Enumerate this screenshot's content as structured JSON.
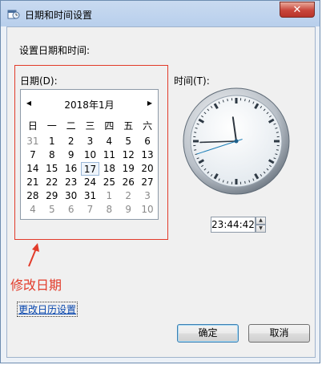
{
  "window": {
    "title": "日期和时间设置",
    "close_label": "✕"
  },
  "heading": "设置日期和时间:",
  "date": {
    "label": "日期(D):",
    "month_title": "2018年1月",
    "prev_glyph": "◀",
    "next_glyph": "▶",
    "weekdays": [
      "日",
      "一",
      "二",
      "三",
      "四",
      "五",
      "六"
    ],
    "days": [
      {
        "t": "31",
        "o": true
      },
      {
        "t": "1"
      },
      {
        "t": "2"
      },
      {
        "t": "3"
      },
      {
        "t": "4"
      },
      {
        "t": "5"
      },
      {
        "t": "6"
      },
      {
        "t": "7"
      },
      {
        "t": "8"
      },
      {
        "t": "9"
      },
      {
        "t": "10"
      },
      {
        "t": "11"
      },
      {
        "t": "12"
      },
      {
        "t": "13"
      },
      {
        "t": "14"
      },
      {
        "t": "15"
      },
      {
        "t": "16"
      },
      {
        "t": "17",
        "sel": true
      },
      {
        "t": "18"
      },
      {
        "t": "19"
      },
      {
        "t": "20"
      },
      {
        "t": "21"
      },
      {
        "t": "22"
      },
      {
        "t": "23"
      },
      {
        "t": "24"
      },
      {
        "t": "25"
      },
      {
        "t": "26"
      },
      {
        "t": "27"
      },
      {
        "t": "28"
      },
      {
        "t": "29"
      },
      {
        "t": "30"
      },
      {
        "t": "31"
      },
      {
        "t": "1",
        "o": true
      },
      {
        "t": "2",
        "o": true
      },
      {
        "t": "3",
        "o": true
      },
      {
        "t": "4",
        "o": true
      },
      {
        "t": "5",
        "o": true
      },
      {
        "t": "6",
        "o": true
      },
      {
        "t": "7",
        "o": true
      },
      {
        "t": "8",
        "o": true
      },
      {
        "t": "9",
        "o": true
      },
      {
        "t": "10",
        "o": true
      }
    ]
  },
  "time": {
    "label": "时间(T):",
    "value": "23:44:42",
    "clock": {
      "hour": 23,
      "minute": 44,
      "second": 42
    }
  },
  "annotation": "修改日期",
  "links": {
    "change_calendar": "更改日历设置"
  },
  "buttons": {
    "ok": "确定",
    "cancel": "取消"
  },
  "colors": {
    "annotation_red": "#e23b2a",
    "link_blue": "#0645ad"
  }
}
